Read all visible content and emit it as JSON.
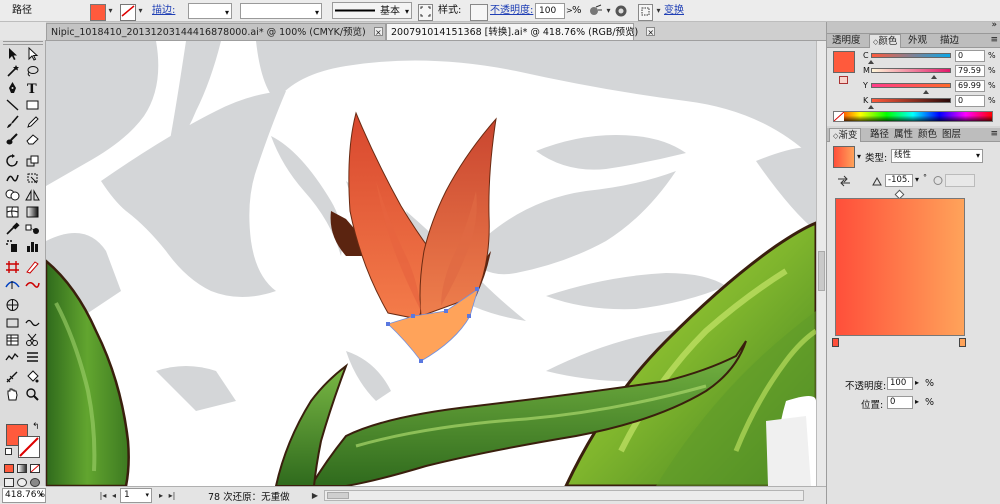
{
  "control_bar": {
    "object_type": "路径",
    "stroke_label": "描边:",
    "stroke_profile": "基本",
    "style_label": "样式:",
    "opacity_label": "不透明度:",
    "opacity_value": "100",
    "opacity_unit": "%",
    "transform_label": "变换"
  },
  "document_tabs": [
    {
      "label": "Nipic_1018410_20131203144416878000.ai* @ 100% (CMYK/预览)",
      "active": false
    },
    {
      "label": "20079101415136​8 [转换].ai* @ 418.76% (RGB/预览)",
      "active": true
    }
  ],
  "status_bar": {
    "zoom": "418.76%",
    "artboard": "1",
    "status_text": "78 次还原：无重做"
  },
  "panels": {
    "top_tabs": [
      "透明度",
      "颜色",
      "外观",
      "描边"
    ],
    "top_active": "颜色",
    "color": {
      "channels": [
        {
          "label": "C",
          "value": "0",
          "fraction": 0.0
        },
        {
          "label": "M",
          "value": "79.59",
          "fraction": 0.7959
        },
        {
          "label": "Y",
          "value": "69.99",
          "fraction": 0.6999
        },
        {
          "label": "K",
          "value": "0",
          "fraction": 0.0
        }
      ],
      "percent": "%"
    },
    "bottom_tabs": [
      "渐变",
      "路径",
      "属性",
      "颜色",
      "图层"
    ],
    "bottom_active": "渐变",
    "gradient": {
      "type_label": "类型:",
      "type_value": "线性",
      "angle_value": "-105.",
      "angle_unit": "°",
      "opacity_label": "不透明度:",
      "opacity_value": "100",
      "location_label": "位置:",
      "location_value": "0",
      "percent": "%"
    }
  },
  "colors": {
    "fill": "#ff5a3c",
    "gradient_start": "#ff4f3a",
    "gradient_end": "#ffa35a",
    "accent_link": "#1f3fb5"
  },
  "icons": [
    "selection-tool-icon",
    "direct-select-icon",
    "magic-wand-icon",
    "lasso-icon",
    "pen-icon",
    "type-icon",
    "line-icon",
    "rectangle-icon",
    "paintbrush-icon",
    "pencil-icon",
    "blob-brush-icon",
    "eraser-icon",
    "rotate-icon",
    "scale-icon",
    "warp-icon",
    "free-transform-icon",
    "shape-builder-icon",
    "perspective-icon",
    "mesh-icon",
    "gradient-icon",
    "eyedropper-icon",
    "blend-icon",
    "symbol-sprayer-icon",
    "column-graph-icon",
    "artboard-icon",
    "slice-icon",
    "hand-icon",
    "zoom-icon"
  ]
}
